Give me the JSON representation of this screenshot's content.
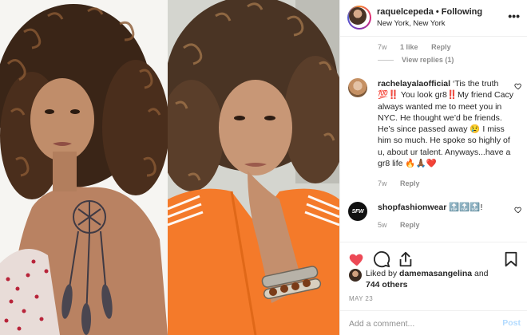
{
  "header": {
    "username": "raquelcepeda",
    "separator": "•",
    "follow_status": "Following",
    "location": "New York, New York",
    "more_icon": "more-options-icon"
  },
  "thread": {
    "prev_comment_meta": {
      "time": "7w",
      "likes": "1 like",
      "reply": "Reply"
    },
    "view_replies": "View replies (1)"
  },
  "comments": [
    {
      "username": "rachelayalaofficial",
      "text": "‘Tis the truth 💯‼️ You look gr8‼️My friend Cacy always wanted me to meet you in NYC. He thought we’d be friends. He’s since passed away 😢 I miss him so much. He spoke so highly of u, about ur talent. Anyways...have a gr8 life 🔥🙏🏾❤️",
      "time": "7w",
      "reply": "Reply"
    },
    {
      "username": "shopfashionwear",
      "avatar_text": "SFW",
      "text": "🔝🔝🔝!",
      "time": "5w",
      "reply": "Reply"
    }
  ],
  "likes": {
    "prefix": "Liked by ",
    "liker": "damemasangelina",
    "middle": " and",
    "others": "744 others"
  },
  "date": "MAY 23",
  "add_comment": {
    "placeholder": "Add a comment...",
    "post_label": "Post"
  },
  "colors": {
    "like_red": "#ed4956",
    "post_disabled_blue": "#b3dbff",
    "secondary_text": "#8e8e8e",
    "jacket_orange": "#f47a2a"
  }
}
